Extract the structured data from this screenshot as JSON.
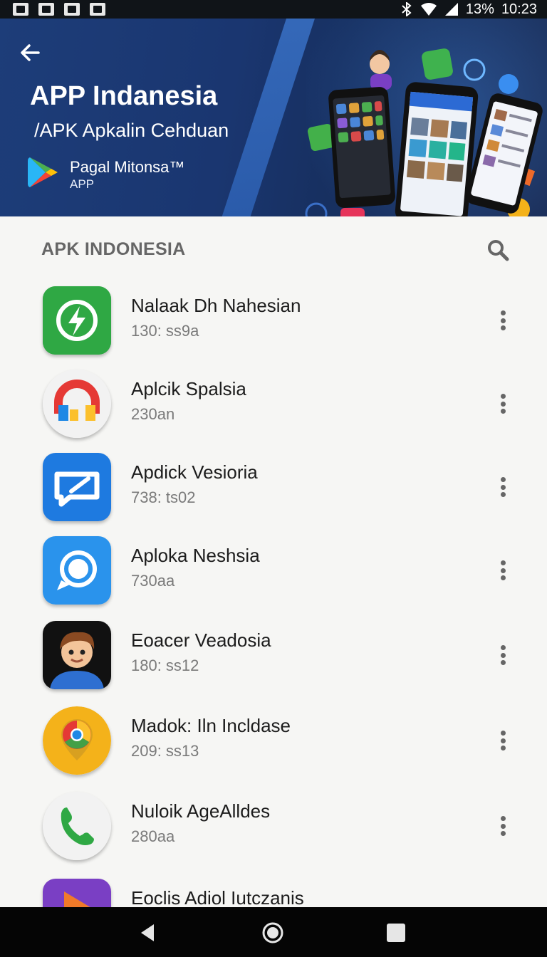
{
  "status_bar": {
    "battery": "13%",
    "time": "10:23",
    "notification_icons": [
      "image-notification-icon",
      "link-notification-icon",
      "music-notification-icon",
      "square-notification-icon"
    ],
    "status_icons": [
      "bluetooth-icon",
      "wifi-icon",
      "signal-icon"
    ]
  },
  "banner": {
    "title": "APP Indanesia",
    "subtitle": "/APK Apkalin Cehduan",
    "store_name": "Pagal Mitonsa™",
    "store_type": "APP",
    "background_color": "#1a3670"
  },
  "section": {
    "title": "APK INDONESIA"
  },
  "apps": [
    {
      "name": "Nalaak Dh Nahesian",
      "meta": "130: ss9a",
      "icon": "lightning-bolt-icon",
      "color": "#2fa844"
    },
    {
      "name": "Aplcik Spalsia",
      "meta": "230an",
      "icon": "colorful-arc-icon",
      "color": "#f2f2f2"
    },
    {
      "name": "Apdick Vesioria",
      "meta": "738: ts02",
      "icon": "chat-bubble-icon",
      "color": "#1e7ae0"
    },
    {
      "name": "Aploka Neshsia",
      "meta": "730aa",
      "icon": "message-circle-icon",
      "color": "#2a93ec"
    },
    {
      "name": "Eoacer Veadosia",
      "meta": "180: ss12",
      "icon": "cartoon-avatar-icon",
      "color": "#111111"
    },
    {
      "name": "Madok: Iln Incldase",
      "meta": "209: ss13",
      "icon": "map-pin-icon",
      "color": "#f4b21a"
    },
    {
      "name": "Nuloik AgeAlldes",
      "meta": "280aa",
      "icon": "phone-icon",
      "color": "#f2f2f2"
    },
    {
      "name": "Eoclis Adiol Iutczanis",
      "meta": "",
      "icon": "play-triangle-icon",
      "color": "#7a3fc4"
    }
  ],
  "nav": {
    "buttons": [
      "back-triangle-icon",
      "home-circle-icon",
      "recents-square-icon"
    ]
  }
}
